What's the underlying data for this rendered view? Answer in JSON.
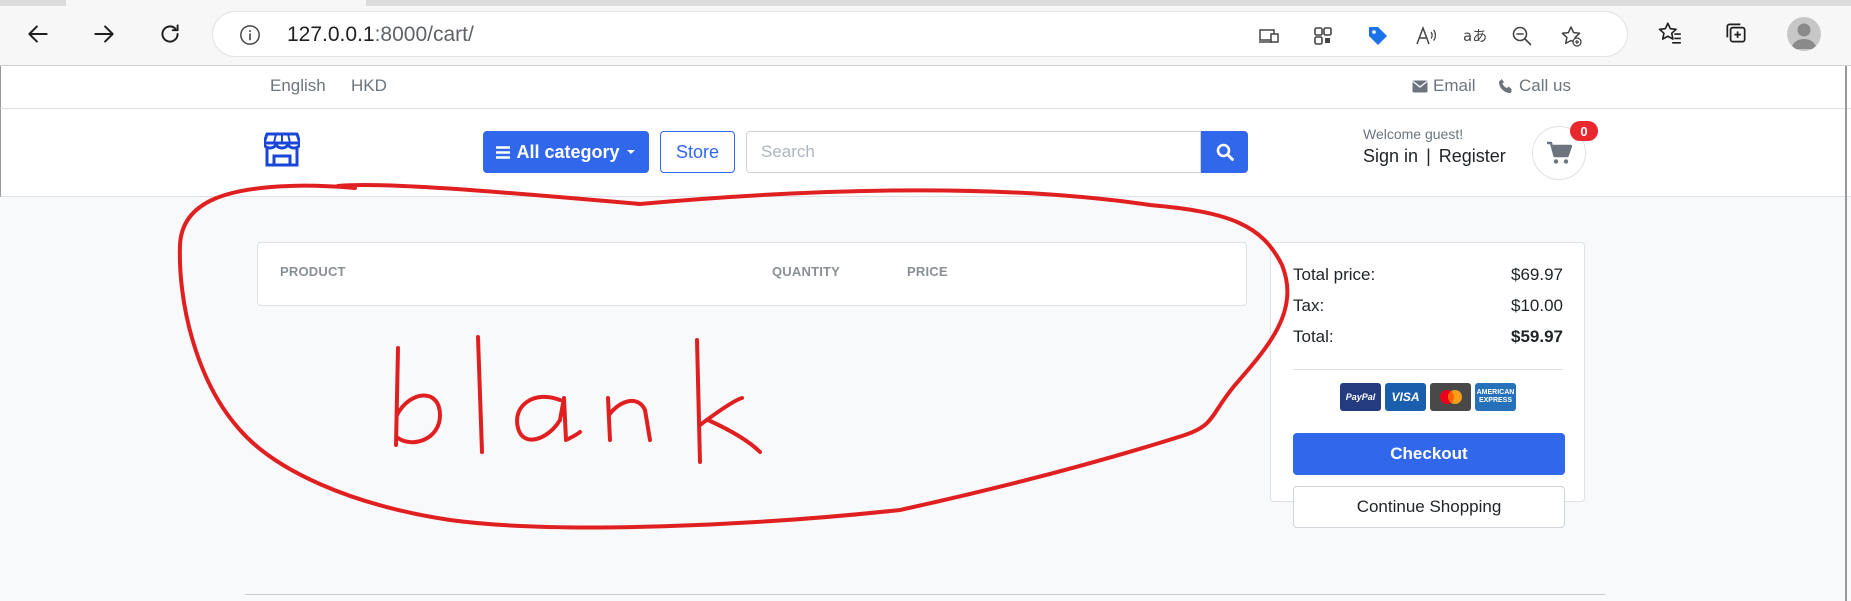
{
  "browser": {
    "url_host": "127.0.0.1",
    "url_path": ":8000/cart/"
  },
  "topbar": {
    "language": "English",
    "currency": "HKD",
    "email_label": "Email",
    "call_label": "Call us"
  },
  "header": {
    "category_label": "All category",
    "store_label": "Store",
    "search_placeholder": "Search",
    "welcome": "Welcome guest!",
    "sign_in": "Sign in",
    "separator": "|",
    "register": "Register",
    "cart_count": "0"
  },
  "cart": {
    "columns": [
      "PRODUCT",
      "QUANTITY",
      "PRICE"
    ]
  },
  "summary": {
    "total_price_label": "Total price:",
    "total_price_value": "$69.97",
    "tax_label": "Tax:",
    "tax_value": "$10.00",
    "total_label": "Total:",
    "total_value": "$59.97",
    "payment_methods": [
      "PayPal",
      "VISA",
      "MasterCard",
      "AMERICAN EXPRESS"
    ],
    "checkout_label": "Checkout",
    "continue_label": "Continue Shopping"
  },
  "annotation": {
    "handwritten_text": "blank",
    "color": "#e02020"
  },
  "colors": {
    "primary": "#3167eb",
    "badge": "#e8272f"
  }
}
